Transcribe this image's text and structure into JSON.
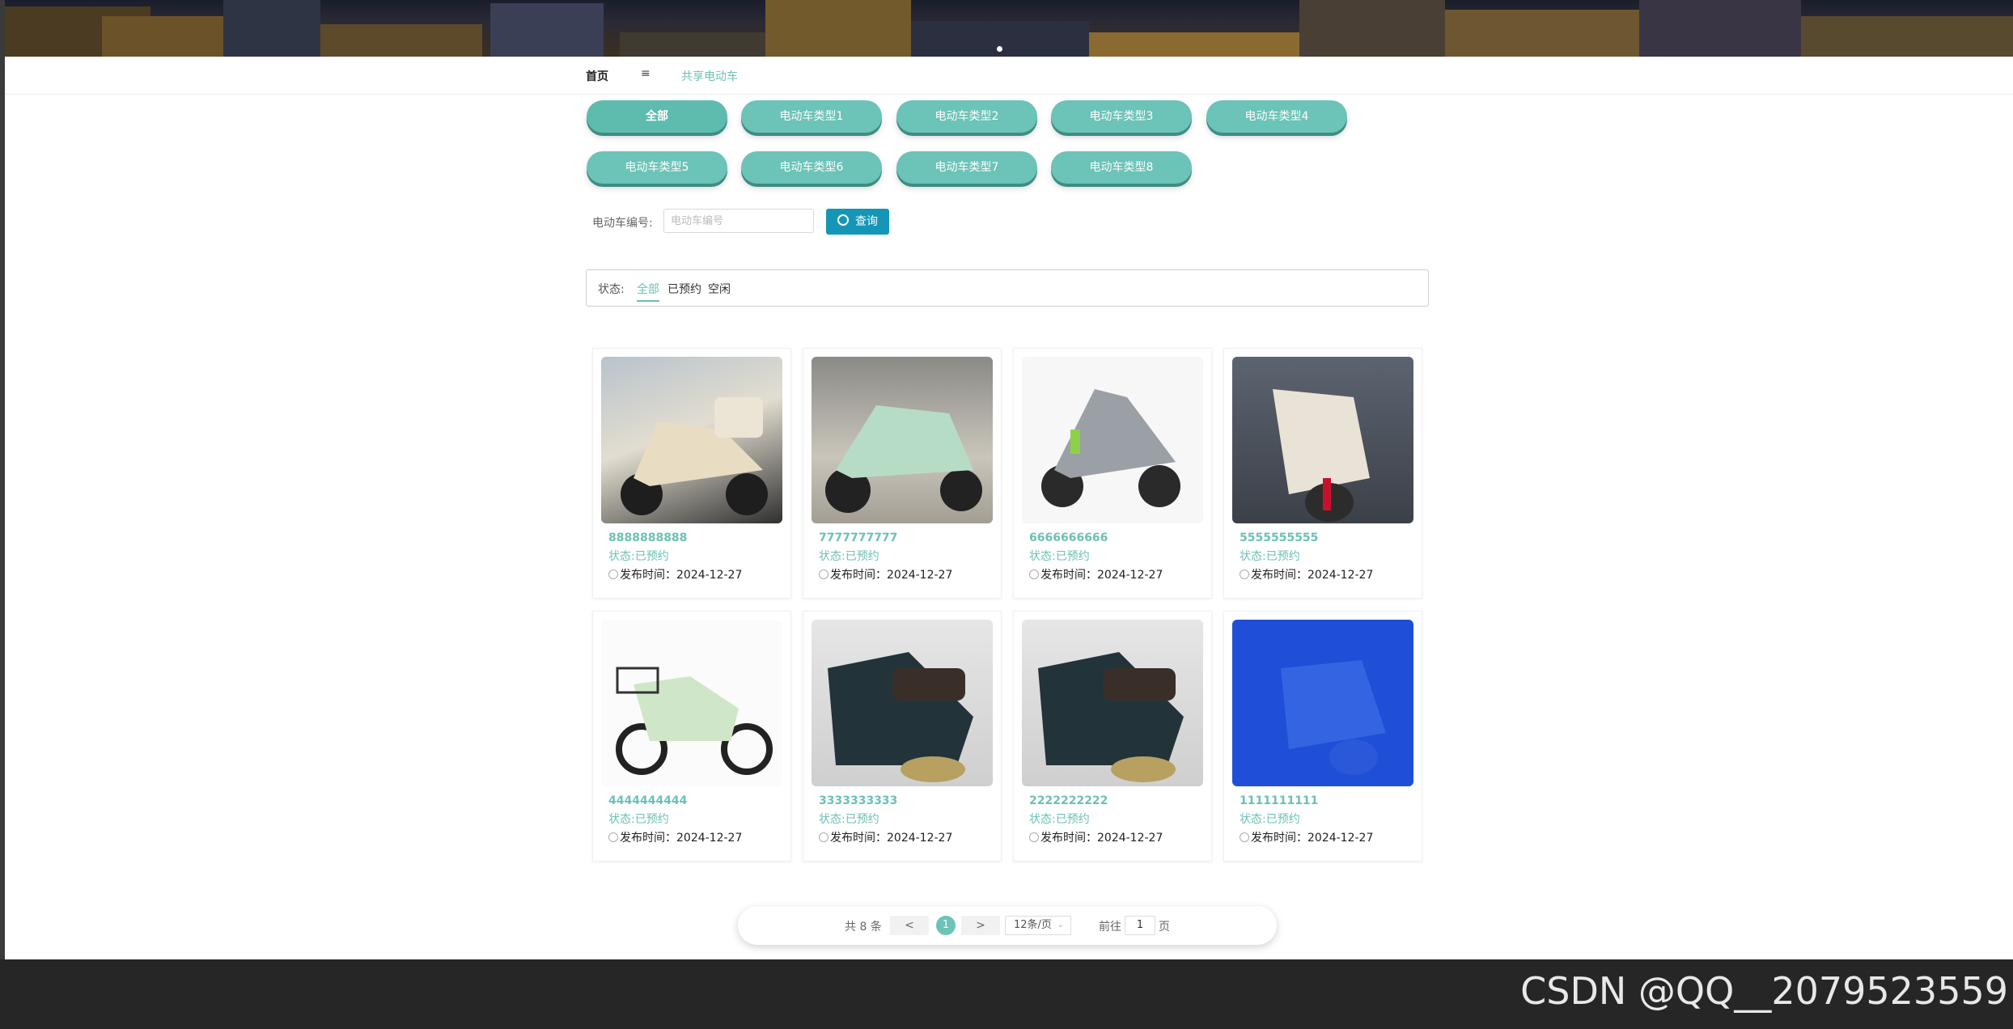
{
  "nav": {
    "home": "首页",
    "menu_icon": "≡",
    "current": "共享电动车"
  },
  "types": [
    "全部",
    "电动车类型1",
    "电动车类型2",
    "电动车类型3",
    "电动车类型4",
    "电动车类型5",
    "电动车类型6",
    "电动车类型7",
    "电动车类型8"
  ],
  "search": {
    "label": "电动车编号:",
    "placeholder": "电动车编号",
    "button": "查询"
  },
  "status_filter": {
    "label": "状态:",
    "options": [
      "全部",
      "已预约",
      "空闲"
    ],
    "active": "全部"
  },
  "cards": [
    {
      "code": "8888888888",
      "status": "状态:已预约",
      "time": "发布时间：2024-12-27"
    },
    {
      "code": "7777777777",
      "status": "状态:已预约",
      "time": "发布时间：2024-12-27"
    },
    {
      "code": "6666666666",
      "status": "状态:已预约",
      "time": "发布时间：2024-12-27"
    },
    {
      "code": "5555555555",
      "status": "状态:已预约",
      "time": "发布时间：2024-12-27"
    },
    {
      "code": "4444444444",
      "status": "状态:已预约",
      "time": "发布时间：2024-12-27"
    },
    {
      "code": "3333333333",
      "status": "状态:已预约",
      "time": "发布时间：2024-12-27"
    },
    {
      "code": "2222222222",
      "status": "状态:已预约",
      "time": "发布时间：2024-12-27"
    },
    {
      "code": "1111111111",
      "status": "状态:已预约",
      "time": "发布时间：2024-12-27"
    }
  ],
  "pagination": {
    "total": "共 8 条",
    "prev": "<",
    "current": "1",
    "next": ">",
    "page_size": "12条/页",
    "goto": "前往",
    "goto_value": "1",
    "page_suffix": "页"
  },
  "watermark": "CSDN @QQ__2079523559",
  "colors": {
    "accent": "#6cc3b7",
    "search_button": "#1696b6",
    "footer": "#262626"
  }
}
